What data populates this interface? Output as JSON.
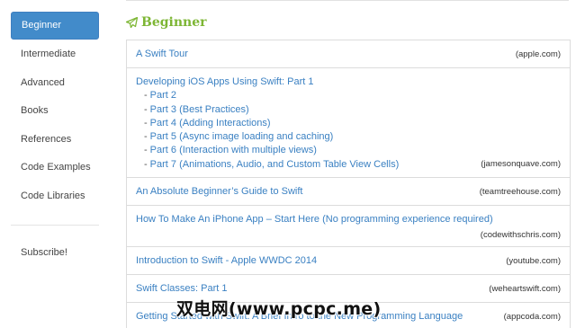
{
  "sidebar": {
    "items": [
      {
        "label": "Beginner",
        "active": true
      },
      {
        "label": "Intermediate"
      },
      {
        "label": "Advanced"
      },
      {
        "label": "Books"
      },
      {
        "label": "References"
      },
      {
        "label": "Code Examples"
      },
      {
        "label": "Code Libraries"
      }
    ],
    "subscribe_label": "Subscribe!"
  },
  "main": {
    "section_title": "Beginner",
    "section_icon": "paper-plane-icon",
    "accent_color": "#7db634",
    "link_color": "#3a80c2",
    "active_nav_color": "#428bca",
    "resources": [
      {
        "title": "A Swift Tour",
        "source": "(apple.com)"
      },
      {
        "title": "Developing iOS Apps Using Swift: Part 1",
        "source": "(jamesonquave.com)",
        "parts": [
          "Part 2",
          "Part 3 (Best Practices)",
          "Part 4 (Adding Interactions)",
          "Part 5 (Async image loading and caching)",
          "Part 6 (Interaction with multiple views)",
          "Part 7 (Animations, Audio, and Custom Table View Cells)"
        ]
      },
      {
        "title": "An Absolute Beginner’s Guide to Swift",
        "source": "(teamtreehouse.com)"
      },
      {
        "title": "How To Make An iPhone App – Start Here (No programming experience required)",
        "source": "(codewithschris.com)"
      },
      {
        "title": "Introduction to Swift - Apple WWDC 2014",
        "source": "(youtube.com)"
      },
      {
        "title": "Swift Classes: Part 1",
        "source": "(weheartswift.com)"
      },
      {
        "title": "Getting Started with Swift: A Brief Intro to the New Programming Language",
        "source": "(appcoda.com)"
      }
    ]
  },
  "watermark": "双电网(www.pcpc.me)"
}
